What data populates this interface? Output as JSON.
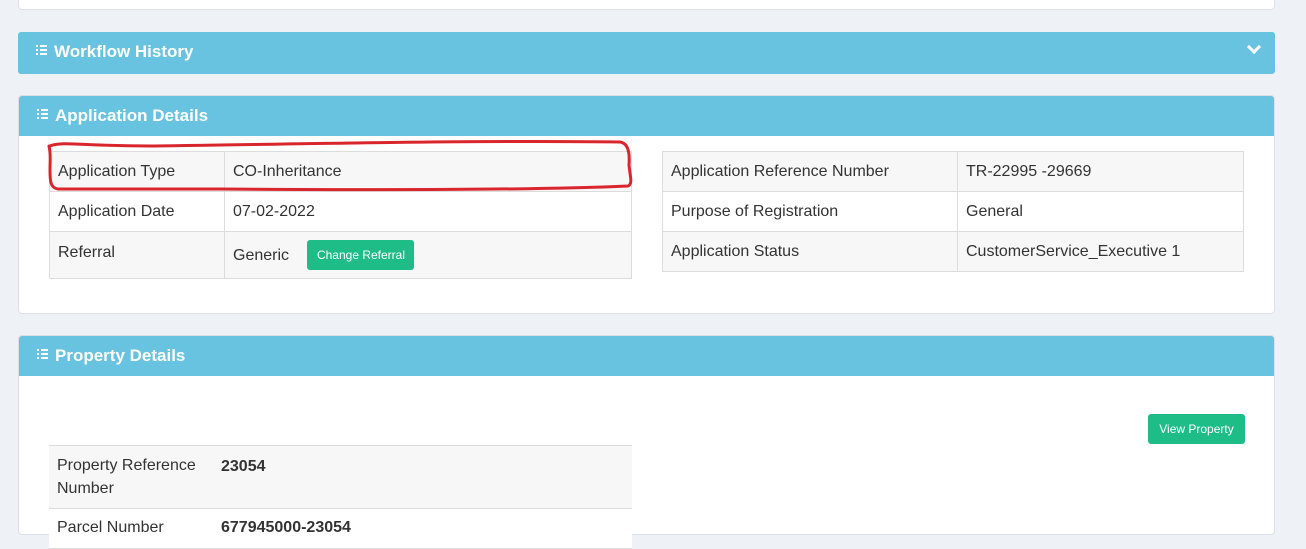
{
  "workflow": {
    "title": "Workflow History"
  },
  "application": {
    "title": "Application Details",
    "left": [
      {
        "label": "Application Type",
        "value": "CO-Inheritance"
      },
      {
        "label": "Application Date",
        "value": "07-02-2022"
      },
      {
        "label": "Referral",
        "value": "Generic",
        "button": "Change Referral"
      }
    ],
    "right": [
      {
        "label": "Application Reference Number",
        "value": "TR-22995 -29669"
      },
      {
        "label": "Purpose of Registration",
        "value": "General"
      },
      {
        "label": "Application Status",
        "value": "CustomerService_Executive 1"
      }
    ]
  },
  "property": {
    "title": "Property Details",
    "view_button": "View Property",
    "rows": [
      {
        "label": "Property Reference Number",
        "value": "23054"
      },
      {
        "label": "Parcel Number",
        "value": "677945000-23054"
      }
    ]
  },
  "colors": {
    "header": "#67c3df",
    "button": "#1ebc87",
    "annotation": "#d9262c"
  }
}
